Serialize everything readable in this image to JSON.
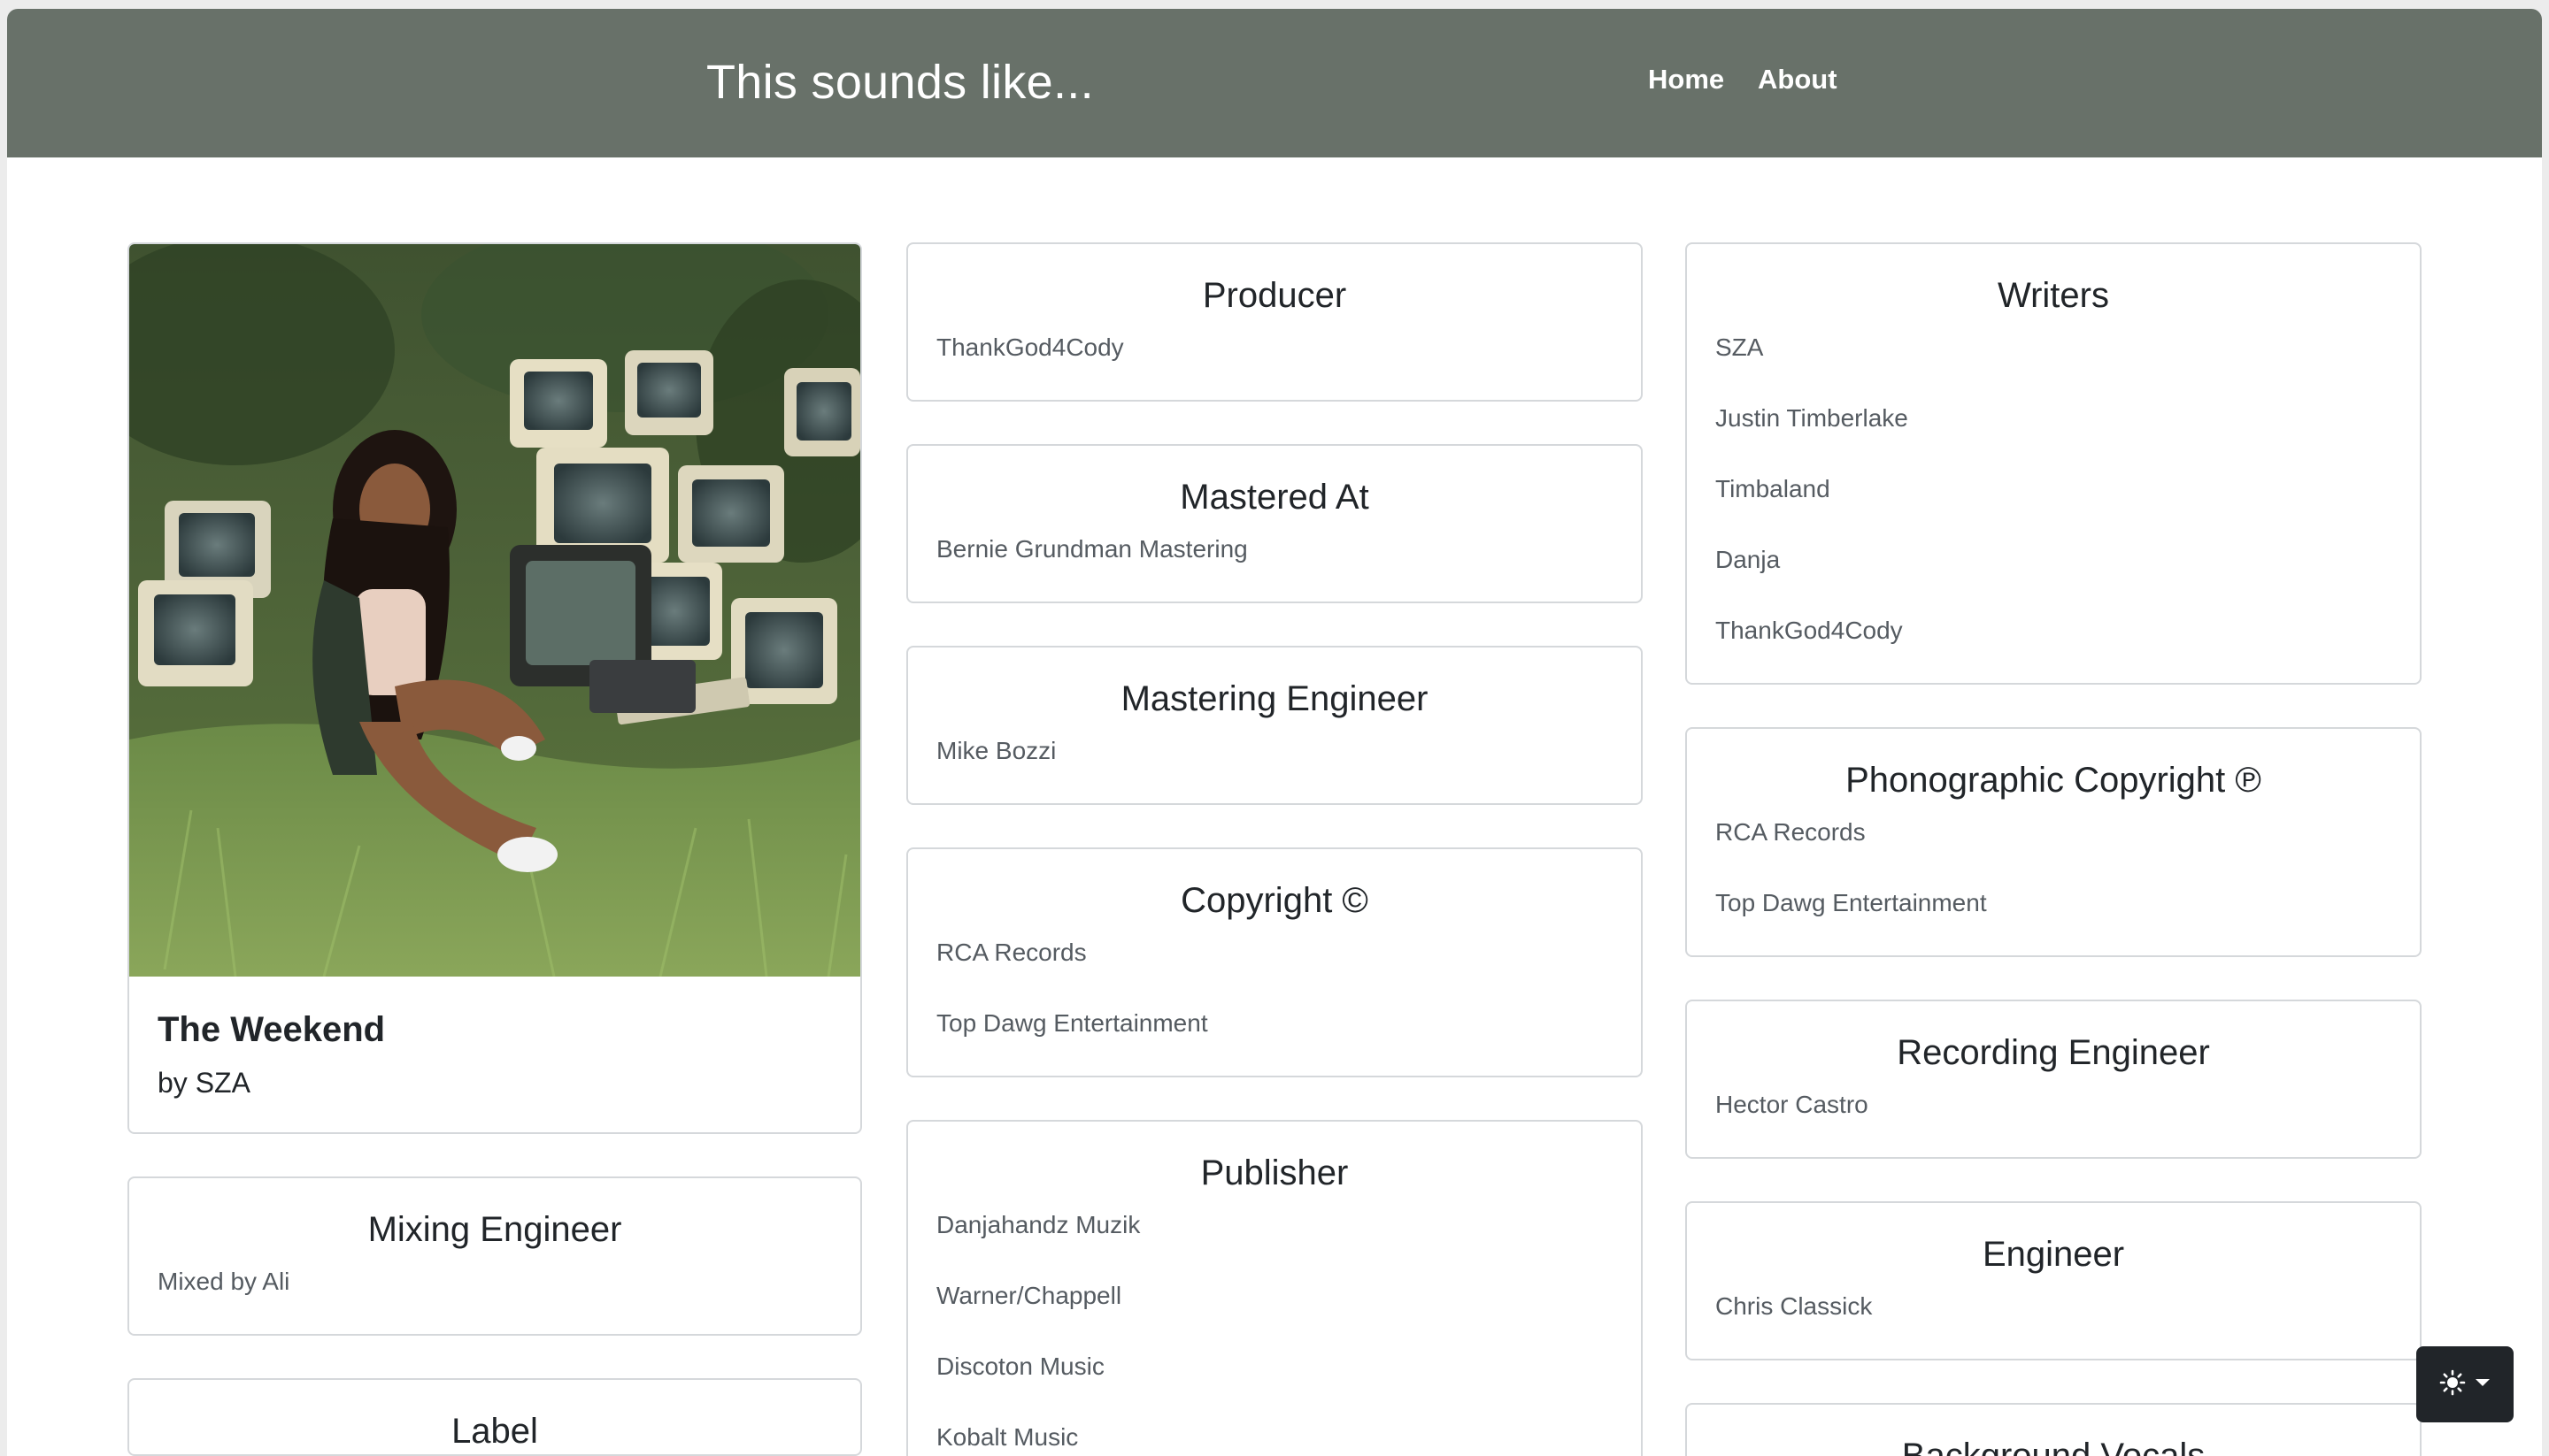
{
  "navbar": {
    "brand": "This sounds like...",
    "links": [
      {
        "label": "Home"
      },
      {
        "label": "About"
      }
    ]
  },
  "album": {
    "title": "The Weekend",
    "artist_line": "by SZA",
    "cover_image": "album-cover-photo"
  },
  "cards": {
    "mixing_engineer": {
      "title": "Mixing Engineer",
      "items": [
        "Mixed by Ali"
      ]
    },
    "label": {
      "title": "Label"
    },
    "producer": {
      "title": "Producer",
      "items": [
        "ThankGod4Cody"
      ]
    },
    "mastered_at": {
      "title": "Mastered At",
      "items": [
        "Bernie Grundman Mastering"
      ]
    },
    "mastering_engineer": {
      "title": "Mastering Engineer",
      "items": [
        "Mike Bozzi"
      ]
    },
    "copyright": {
      "title": "Copyright ©",
      "items": [
        "RCA Records",
        "Top Dawg Entertainment"
      ]
    },
    "publisher": {
      "title": "Publisher",
      "items": [
        "Danjahandz Muzik",
        "Warner/Chappell",
        "Discoton Music",
        "Kobalt Music"
      ]
    },
    "writers": {
      "title": "Writers",
      "items": [
        "SZA",
        "Justin Timberlake",
        "Timbaland",
        "Danja",
        "ThankGod4Cody"
      ]
    },
    "phonographic_copyright": {
      "title": "Phonographic Copyright ℗",
      "items": [
        "RCA Records",
        "Top Dawg Entertainment"
      ]
    },
    "recording_engineer": {
      "title": "Recording Engineer",
      "items": [
        "Hector Castro"
      ]
    },
    "engineer": {
      "title": "Engineer",
      "items": [
        "Chris Classick"
      ]
    },
    "background_vocals": {
      "title": "Background Vocals"
    }
  },
  "theme_toggle": {
    "icon": "sun-icon",
    "caret": "caret-down-icon"
  },
  "colors": {
    "navbar": "#687169",
    "card_border": "#d5d8db",
    "theme_button": "#212529"
  }
}
